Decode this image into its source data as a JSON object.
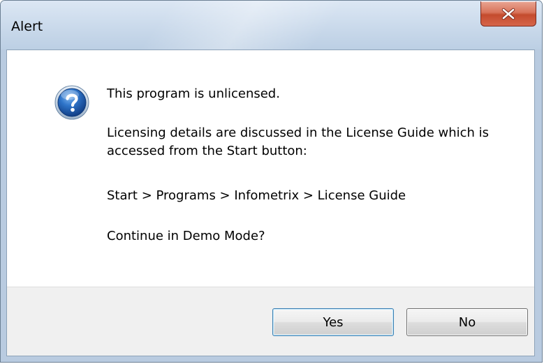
{
  "window": {
    "title": "Alert"
  },
  "dialog": {
    "icon": "question-icon",
    "message_line1": "This program is unlicensed.",
    "message_line2": "Licensing details are discussed in the License Guide which is accessed from the Start button:",
    "message_line3": "Start > Programs > Infometrix > License Guide",
    "message_line4": "Continue in Demo Mode?"
  },
  "buttons": {
    "yes_label": "Yes",
    "no_label": "No"
  },
  "colors": {
    "close_button": "#c44b2e",
    "icon_blue": "#1f5fb0",
    "default_button_border": "#3c7fb1"
  }
}
